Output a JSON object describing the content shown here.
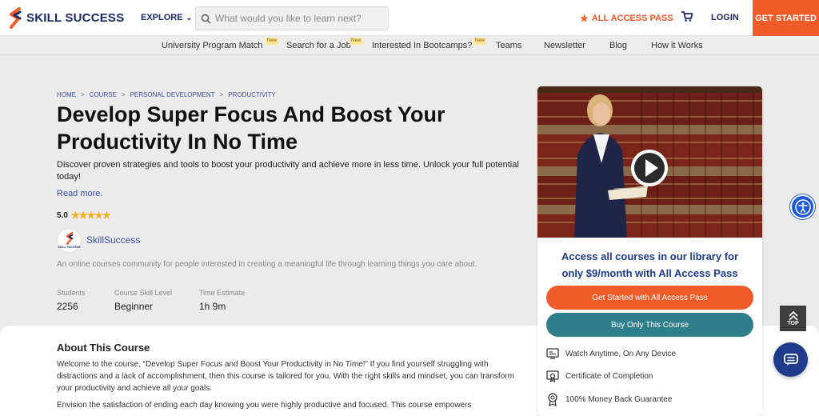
{
  "header": {
    "logo_text": "SKILL SUCCESS",
    "explore_label": "EXPLORE",
    "search_placeholder": "What would you like to learn next?",
    "all_access_label": "ALL ACCESS PASS",
    "login_label": "LOGIN",
    "get_started_label": "GET STARTED",
    "accent_color": "#f05a28",
    "brand_color": "#1b2a6b"
  },
  "subnav": {
    "items": [
      {
        "label": "University Program Match",
        "badge": "New"
      },
      {
        "label": "Search for a Job",
        "badge": "New"
      },
      {
        "label": "Interested In Bootcamps?",
        "badge": "New"
      },
      {
        "label": "Teams"
      },
      {
        "label": "Newsletter"
      },
      {
        "label": "Blog"
      },
      {
        "label": "How it Works"
      }
    ]
  },
  "breadcrumb": [
    "HOME",
    "COURSE",
    "PERSONAL DEVELOPMENT",
    "PRODUCTIVITY"
  ],
  "course": {
    "title": "Develop Super Focus And Boost Your Productivity In No Time",
    "description": "Discover proven strategies and tools to boost your productivity and achieve more in less time. Unlock your full potential today!",
    "read_more": "Read more.",
    "rating": "5.0",
    "stars": 5,
    "author_name": "SkillSuccess",
    "author_avatar_text": "SKILL SUCCESS",
    "author_description": "An online courses community for people interested in creating a meaningful life through learning things you care about.",
    "stats": [
      {
        "label": "Students",
        "value": "2256"
      },
      {
        "label": "Course Skill Level",
        "value": "Beginner"
      },
      {
        "label": "Time Estimate",
        "value": "1h 9m"
      }
    ]
  },
  "about": {
    "title": "About This Course",
    "paragraphs": [
      "Welcome to the course, “Develop Super Focus and Boost Your Productivity in No Time!” If you find yourself struggling with distractions and a lack of accomplishment, then this course is tailored for you. With the right skills and mindset, you can transform your productivity and achieve all your goals.",
      "Envision the satisfaction of ending each day knowing you were highly productive and focused. This course empowers"
    ]
  },
  "sidebar": {
    "access_line1": "Access all courses in our library for",
    "access_line2": "only $9/month with All Access Pass",
    "primary_button": "Get Started with All Access Pass",
    "secondary_button": "Buy Only This Course",
    "features": [
      {
        "icon": "device-icon",
        "label": "Watch Anytime, On Any Device"
      },
      {
        "icon": "certificate-icon",
        "label": "Certificate of Completion"
      },
      {
        "icon": "guarantee-icon",
        "label": "100% Money Back Guarantee"
      }
    ]
  },
  "floating": {
    "top_label": "TOP"
  }
}
